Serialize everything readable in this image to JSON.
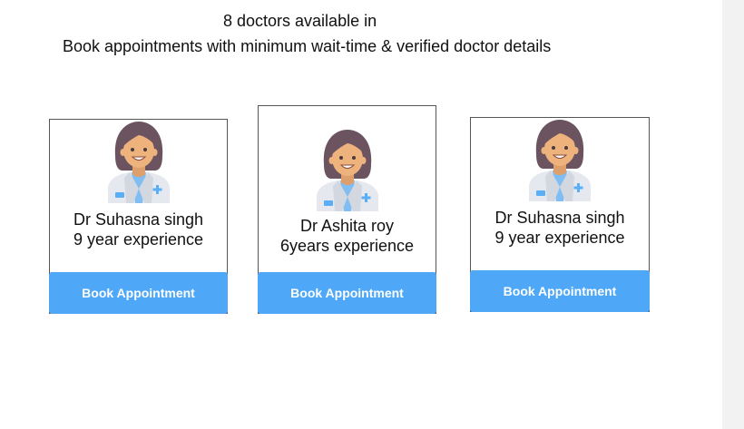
{
  "header": {
    "line1": "8 doctors available in",
    "line2": "Book appointments with minimum wait-time & verified doctor details"
  },
  "doctors": [
    {
      "name": "Dr Suhasna singh",
      "experience": "9  year experience",
      "button": "Book Appointment"
    },
    {
      "name": "Dr Ashita roy",
      "experience": "6years experience",
      "button": "Book Appointment"
    },
    {
      "name": "Dr Suhasna singh",
      "experience": "9  year experience",
      "button": "Book Appointment"
    }
  ],
  "colors": {
    "button": "#4ea8f7",
    "hair": "#6b5460",
    "skin": "#eeb27d",
    "coat": "#e5e8ee",
    "cross": "#5aaef5"
  },
  "icons": {
    "avatar": "female-doctor-avatar-icon"
  }
}
